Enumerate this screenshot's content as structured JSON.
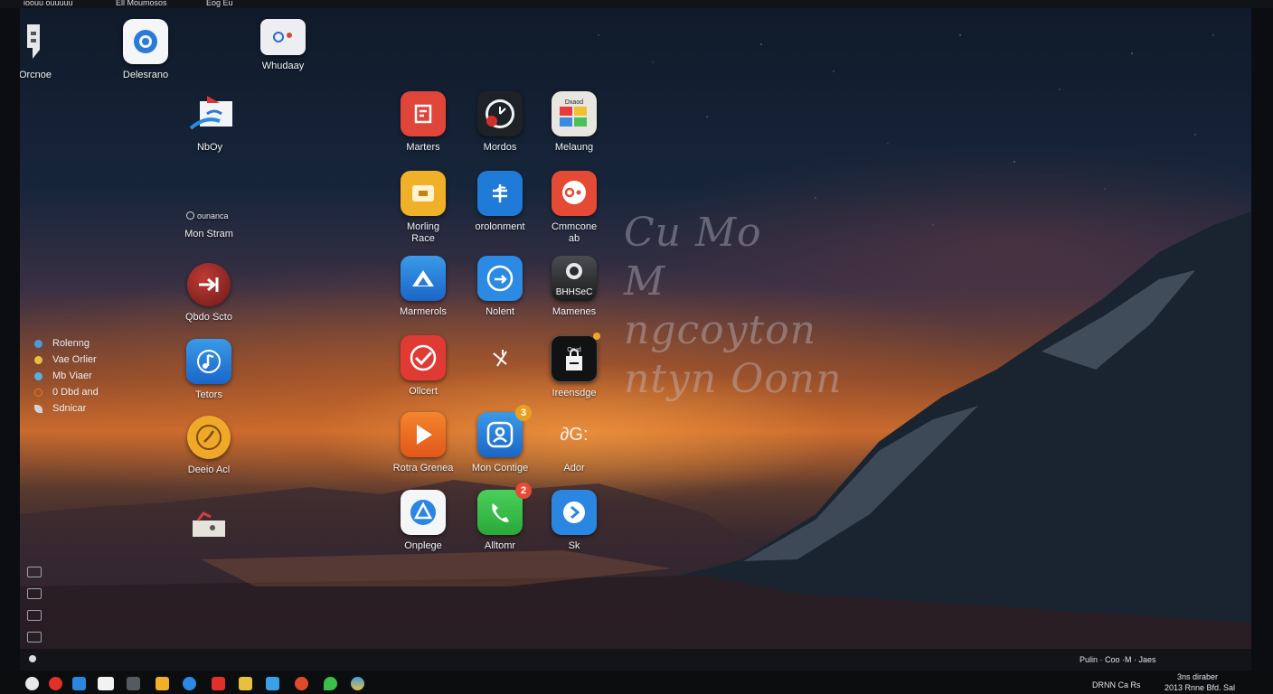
{
  "menubar": {
    "items": [
      "ioouu ouuuuu",
      "Ell  Moumosos",
      "Eog  Eu"
    ]
  },
  "desktop_left": [
    {
      "label": "Orcnoe",
      "icon": "face-silhouette-icon"
    },
    {
      "label": "Delesrano",
      "icon": "camera-lens-icon"
    },
    {
      "label": "Whudaay",
      "icon": "toggle-switch-icon"
    },
    {
      "label": "NbOy",
      "icon": "mail-tray-icon"
    }
  ],
  "left_column": [
    {
      "label": "Mon Stram",
      "top_text": "ounanca",
      "icon": "ring-icon"
    },
    {
      "label": "Qbdo Scto",
      "icon": "arrow-exit-icon"
    },
    {
      "label": "Tetors",
      "icon": "music-note-icon"
    },
    {
      "label": "Deeio Acl",
      "icon": "clock-icon"
    }
  ],
  "sidebar_list": [
    {
      "label": "Rolenng",
      "color": "#4a9ae0"
    },
    {
      "label": "Vae Orlier",
      "color": "#e8c040"
    },
    {
      "label": "Mb Viaer",
      "color": "#5aaee8"
    },
    {
      "label": "0 Dbd and",
      "color": "#e07a2a"
    },
    {
      "label": "Sdnicar",
      "color": "#d0d4da"
    }
  ],
  "grid_icons": [
    {
      "label": "Marters",
      "icon": "document-red-icon",
      "bg": "#e0453a"
    },
    {
      "label": "Mordos",
      "icon": "clock-dark-icon",
      "bg": "#1e2226"
    },
    {
      "label": "Melaung",
      "icon": "wallet-cards-icon",
      "bg": "#e8e6e0",
      "top_text": "Dxaod"
    },
    {
      "label": "Morling\nRace",
      "icon": "photo-yellow-icon",
      "bg": "#f0b028"
    },
    {
      "label": "orolonment",
      "icon": "share-blue-icon",
      "bg": "#1f7ad8"
    },
    {
      "label": "Cmmcone\nab",
      "icon": "chat-red-icon",
      "bg": "#e54a34"
    },
    {
      "label": "Marmerols",
      "icon": "triangle-blue-icon",
      "bg": "#2a86e0"
    },
    {
      "label": "Nolent",
      "icon": "circle-arrow-icon",
      "bg": "#2a8ae4"
    },
    {
      "label": "Mamenes",
      "icon": "photo-dark-icon",
      "bg": "#2a2c30",
      "top_text": "BHHSeC"
    },
    {
      "label": "Ollcert",
      "icon": "checkmark-red-icon",
      "bg": "#e03a34"
    },
    {
      "label": "",
      "icon": "sparkle-icon",
      "bg": "transparent"
    },
    {
      "label": "Ireensdge",
      "icon": "shopping-bag-icon",
      "bg": "#111214",
      "top_text": "Orud"
    },
    {
      "label": "Rotra Grenea",
      "icon": "play-icon",
      "bg": "#ee6a24"
    },
    {
      "label": "Mon Contige",
      "icon": "contact-icon",
      "bg": "#2a86e0",
      "badge": "3",
      "badge_color": "#e8a020"
    },
    {
      "label": "Ador",
      "icon": "text-glyph-icon",
      "bg": "transparent",
      "glyph_text": "∂G:"
    },
    {
      "label": "Onplege",
      "icon": "appstore-icon",
      "bg": "#f4f6f8"
    },
    {
      "label": "Alltomr",
      "icon": "phone-icon",
      "bg": "#3cc24a",
      "badge": "2",
      "badge_color": "#e84a3a"
    },
    {
      "label": "Sk",
      "icon": "circle-chevron-icon",
      "bg": "#2a86e0"
    }
  ],
  "watermark": "Cu Mo\nM ngcoyton\nntyn Oonn",
  "statusbar": {
    "right_text": "Pulin  ·  Coo ·M  ·  Jaes"
  },
  "tray": {
    "label": "DRNN  Ca Rs",
    "line1": "3ns diraber",
    "line2": "2013 Rnne Bfd. Sal"
  }
}
